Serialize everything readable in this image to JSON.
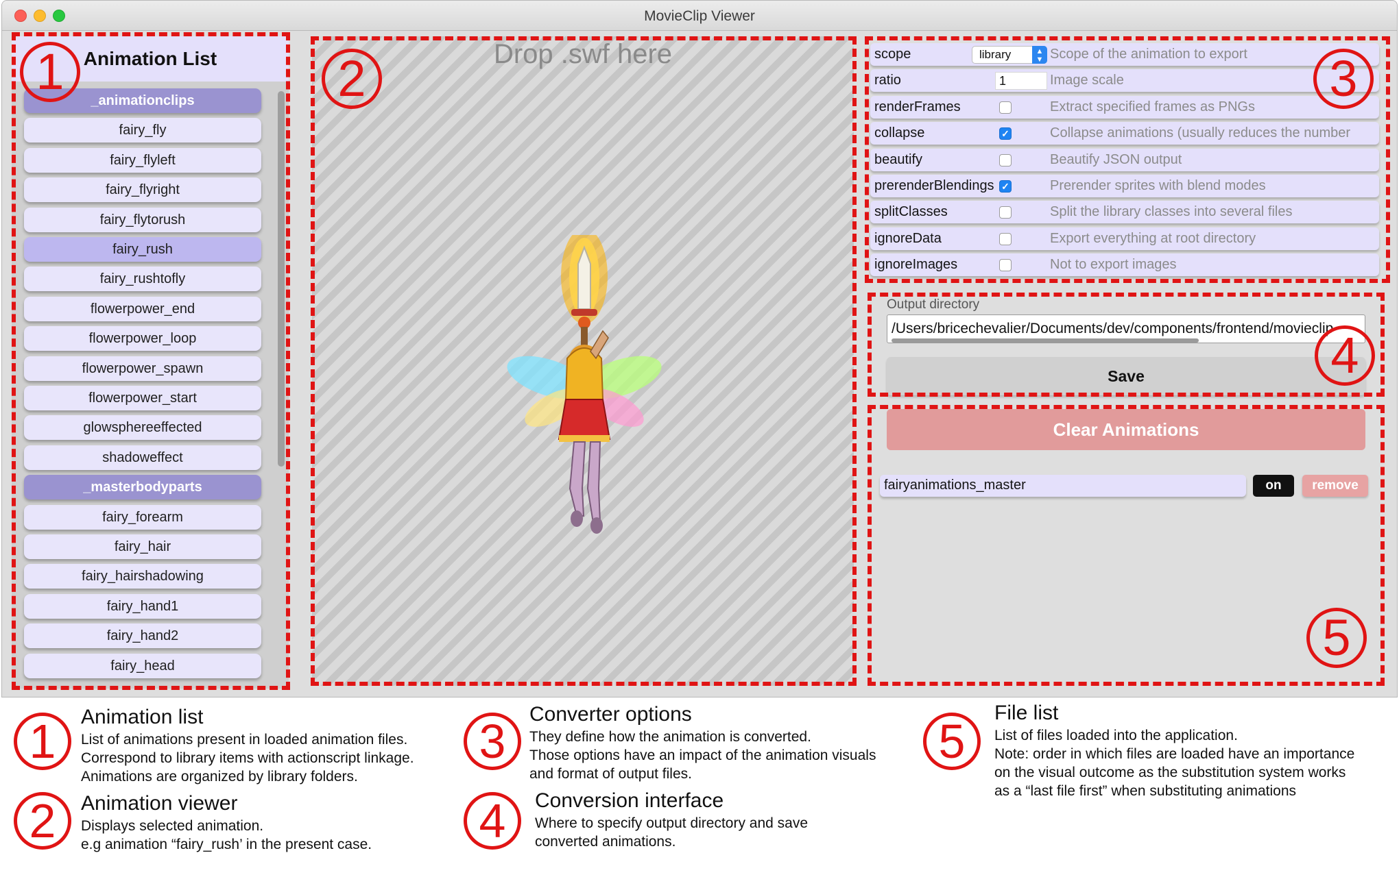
{
  "window": {
    "title": "MovieClip Viewer"
  },
  "anim_list": {
    "title": "Animation List",
    "items": [
      {
        "label": "_animationclips",
        "kind": "folder"
      },
      {
        "label": "fairy_fly",
        "kind": "item"
      },
      {
        "label": "fairy_flyleft",
        "kind": "item"
      },
      {
        "label": "fairy_flyright",
        "kind": "item"
      },
      {
        "label": "fairy_flytorush",
        "kind": "item"
      },
      {
        "label": "fairy_rush",
        "kind": "selected"
      },
      {
        "label": "fairy_rushtofly",
        "kind": "item"
      },
      {
        "label": "flowerpower_end",
        "kind": "item"
      },
      {
        "label": "flowerpower_loop",
        "kind": "item"
      },
      {
        "label": "flowerpower_spawn",
        "kind": "item"
      },
      {
        "label": "flowerpower_start",
        "kind": "item"
      },
      {
        "label": "glowsphereeffected",
        "kind": "item"
      },
      {
        "label": "shadoweffect",
        "kind": "item"
      },
      {
        "label": "_masterbodyparts",
        "kind": "folder"
      },
      {
        "label": "fairy_forearm",
        "kind": "item"
      },
      {
        "label": "fairy_hair",
        "kind": "item"
      },
      {
        "label": "fairy_hairshadowing",
        "kind": "item"
      },
      {
        "label": "fairy_hand1",
        "kind": "item"
      },
      {
        "label": "fairy_hand2",
        "kind": "item"
      },
      {
        "label": "fairy_head",
        "kind": "item"
      }
    ]
  },
  "viewer": {
    "drop_text": "Drop .swf here"
  },
  "options": [
    {
      "name": "scope",
      "control": "select",
      "value": "library",
      "desc": "Scope of the animation to export"
    },
    {
      "name": "ratio",
      "control": "input",
      "value": "1",
      "desc": "Image scale"
    },
    {
      "name": "renderFrames",
      "control": "checkbox",
      "checked": false,
      "desc": "Extract specified frames as PNGs"
    },
    {
      "name": "collapse",
      "control": "checkbox",
      "checked": true,
      "desc": "Collapse animations (usually reduces the number"
    },
    {
      "name": "beautify",
      "control": "checkbox",
      "checked": false,
      "desc": "Beautify JSON output"
    },
    {
      "name": "prerenderBlendings",
      "control": "checkbox",
      "checked": true,
      "desc": "Prerender sprites with blend modes"
    },
    {
      "name": "splitClasses",
      "control": "checkbox",
      "checked": false,
      "desc": "Split the library classes into several files"
    },
    {
      "name": "ignoreData",
      "control": "checkbox",
      "checked": false,
      "desc": "Export everything at root directory"
    },
    {
      "name": "ignoreImages",
      "control": "checkbox",
      "checked": false,
      "desc": "Not to export images"
    }
  ],
  "output": {
    "label": "Output directory",
    "value": "/Users/bricechevalier/Documents/dev/components/frontend/movieclip",
    "save_label": "Save"
  },
  "files": {
    "clear_label": "Clear Animations",
    "items": [
      {
        "name": "fairyanimations_master",
        "on_label": "on",
        "remove_label": "remove"
      }
    ]
  },
  "annotations": {
    "numbers": [
      "1",
      "2",
      "3",
      "4",
      "5"
    ],
    "color": "#e01414"
  },
  "legend": [
    {
      "num": "1",
      "title": "Animation list",
      "lines": [
        "List of animations present in loaded animation files.",
        "Correspond to library items with actionscript linkage.",
        "Animations are organized by library folders."
      ]
    },
    {
      "num": "2",
      "title": "Animation viewer",
      "lines": [
        "Displays selected animation.",
        "e.g animation “fairy_rush’ in the present case."
      ]
    },
    {
      "num": "3",
      "title": "Converter options",
      "lines": [
        "They define how the animation is converted.",
        "Those options have an impact of the animation visuals",
        "and format of output files."
      ]
    },
    {
      "num": "4",
      "title": "Conversion interface",
      "lines": [
        "Where to specify output directory and save",
        "converted animations."
      ]
    },
    {
      "num": "5",
      "title": "File list",
      "lines": [
        "List of files loaded into the application.",
        "Note: order in which files are loaded have an importance",
        "on the visual outcome as the substitution system works",
        "as a “last file first” when substituting animations"
      ]
    }
  ],
  "colors": {
    "list_item": "#e8e5fb",
    "folder": "#9a93d0",
    "selected": "#bdb7ef",
    "clear": "#e19b9b",
    "remove": "#e7a3a3"
  }
}
